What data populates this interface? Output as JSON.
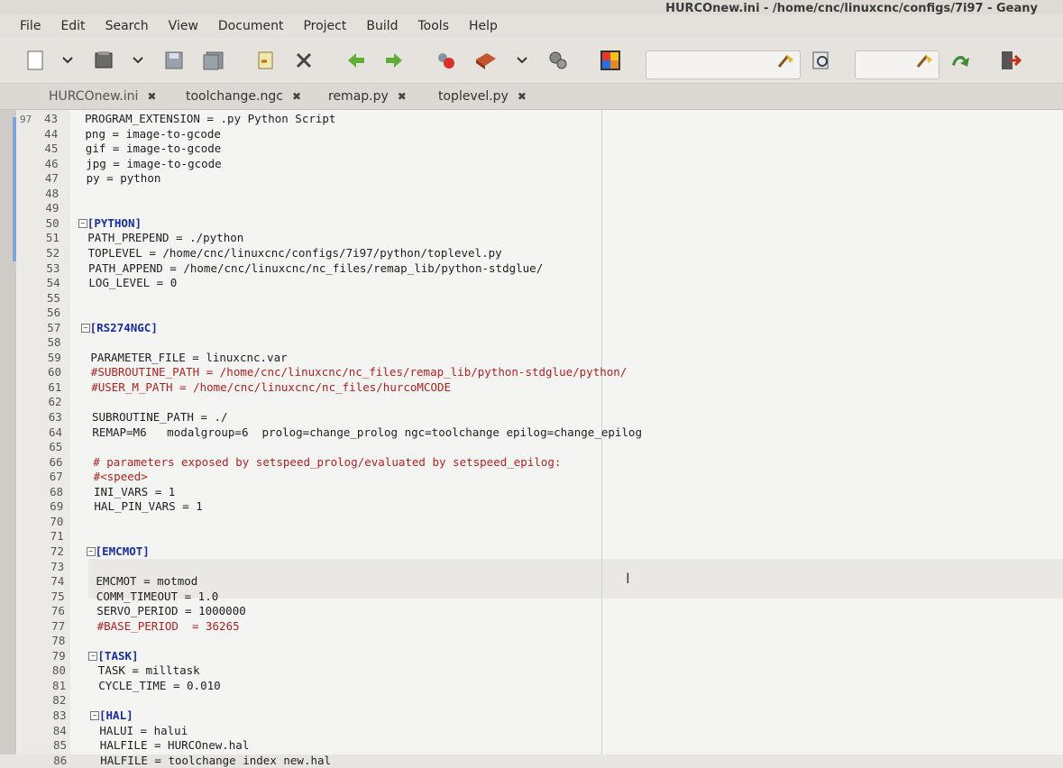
{
  "window": {
    "title": "HURCOnew.ini - /home/cnc/linuxcnc/configs/7i97 - Geany"
  },
  "menu": [
    "File",
    "Edit",
    "Search",
    "View",
    "Document",
    "Project",
    "Build",
    "Tools",
    "Help"
  ],
  "toolbar": {
    "icons": [
      "new-file-icon",
      "dropdown-arrow-icon",
      "open-file-icon",
      "dropdown-arrow-icon",
      "save-icon",
      "save-all-icon",
      "revert-icon",
      "close-icon",
      "back-arrow-icon",
      "forward-arrow-icon",
      "compile-icon",
      "build-icon",
      "dropdown-arrow-icon",
      "execute-icon",
      "color-chooser-icon",
      "clear-search-icon",
      "find-icon",
      "clear-goto-icon",
      "goto-line-icon",
      "quit-icon"
    ]
  },
  "tabs": [
    {
      "label": "HURCOnew.ini",
      "active": true
    },
    {
      "label": "toolchange.ngc",
      "active": false
    },
    {
      "label": "remap.py",
      "active": false
    },
    {
      "label": "toplevel.py",
      "active": false
    }
  ],
  "editor": {
    "partial_num": "97",
    "lines": [
      {
        "num": "43",
        "text": "PROGRAM_EXTENSION = .py Python Script",
        "type": "normal"
      },
      {
        "num": "44",
        "text": "png = image-to-gcode",
        "type": "normal"
      },
      {
        "num": "45",
        "text": "gif = image-to-gcode",
        "type": "normal"
      },
      {
        "num": "46",
        "text": "jpg = image-to-gcode",
        "type": "normal"
      },
      {
        "num": "47",
        "text": "py = python",
        "type": "normal"
      },
      {
        "num": "48",
        "text": "",
        "type": "normal"
      },
      {
        "num": "49",
        "text": "",
        "type": "normal"
      },
      {
        "num": "50",
        "text": "[PYTHON]",
        "type": "section"
      },
      {
        "num": "51",
        "text": "PATH_PREPEND = ./python",
        "type": "normal"
      },
      {
        "num": "52",
        "text": "TOPLEVEL = /home/cnc/linuxcnc/configs/7i97/python/toplevel.py",
        "type": "normal"
      },
      {
        "num": "53",
        "text": "PATH_APPEND = /home/cnc/linuxcnc/nc_files/remap_lib/python-stdglue/",
        "type": "normal"
      },
      {
        "num": "54",
        "text": "LOG_LEVEL = 0",
        "type": "normal"
      },
      {
        "num": "55",
        "text": "",
        "type": "normal"
      },
      {
        "num": "56",
        "text": "",
        "type": "normal"
      },
      {
        "num": "57",
        "text": "[RS274NGC]",
        "type": "section"
      },
      {
        "num": "58",
        "text": "",
        "type": "normal"
      },
      {
        "num": "59",
        "text": "PARAMETER_FILE = linuxcnc.var",
        "type": "normal"
      },
      {
        "num": "60",
        "text": "#SUBROUTINE_PATH = /home/cnc/linuxcnc/nc_files/remap_lib/python-stdglue/python/",
        "type": "comment"
      },
      {
        "num": "61",
        "text": "#USER_M_PATH = /home/cnc/linuxcnc/nc_files/hurcoMCODE",
        "type": "comment"
      },
      {
        "num": "62",
        "text": "",
        "type": "normal"
      },
      {
        "num": "63",
        "text": "SUBROUTINE_PATH = ./",
        "type": "normal"
      },
      {
        "num": "64",
        "text": "REMAP=M6   modalgroup=6  prolog=change_prolog ngc=toolchange epilog=change_epilog",
        "type": "normal"
      },
      {
        "num": "65",
        "text": "",
        "type": "normal"
      },
      {
        "num": "66",
        "text": "# parameters exposed by setspeed_prolog/evaluated by setspeed_epilog:",
        "type": "comment"
      },
      {
        "num": "67",
        "text": "#<speed>",
        "type": "comment"
      },
      {
        "num": "68",
        "text": "INI_VARS = 1",
        "type": "normal"
      },
      {
        "num": "69",
        "text": "HAL_PIN_VARS = 1",
        "type": "normal"
      },
      {
        "num": "70",
        "text": "",
        "type": "normal"
      },
      {
        "num": "71",
        "text": "",
        "type": "normal"
      },
      {
        "num": "72",
        "text": "[EMCMOT]",
        "type": "section"
      },
      {
        "num": "73",
        "text": "",
        "type": "normal"
      },
      {
        "num": "74",
        "text": "EMCMOT = motmod",
        "type": "normal"
      },
      {
        "num": "75",
        "text": "COMM_TIMEOUT = 1.0",
        "type": "normal"
      },
      {
        "num": "76",
        "text": "SERVO_PERIOD = 1000000",
        "type": "normal"
      },
      {
        "num": "77",
        "text": "#BASE_PERIOD  = 36265",
        "type": "comment"
      },
      {
        "num": "78",
        "text": "",
        "type": "normal"
      },
      {
        "num": "79",
        "text": "[TASK]",
        "type": "section"
      },
      {
        "num": "80",
        "text": "TASK = milltask",
        "type": "normal"
      },
      {
        "num": "81",
        "text": "CYCLE_TIME = 0.010",
        "type": "normal"
      },
      {
        "num": "82",
        "text": "",
        "type": "normal"
      },
      {
        "num": "83",
        "text": "[HAL]",
        "type": "section"
      },
      {
        "num": "84",
        "text": "HALUI = halui",
        "type": "normal"
      },
      {
        "num": "85",
        "text": "HALFILE = HURCOnew.hal",
        "type": "normal"
      },
      {
        "num": "86",
        "text": "HALFILE = toolchange index new.hal",
        "type": "normal"
      }
    ]
  }
}
